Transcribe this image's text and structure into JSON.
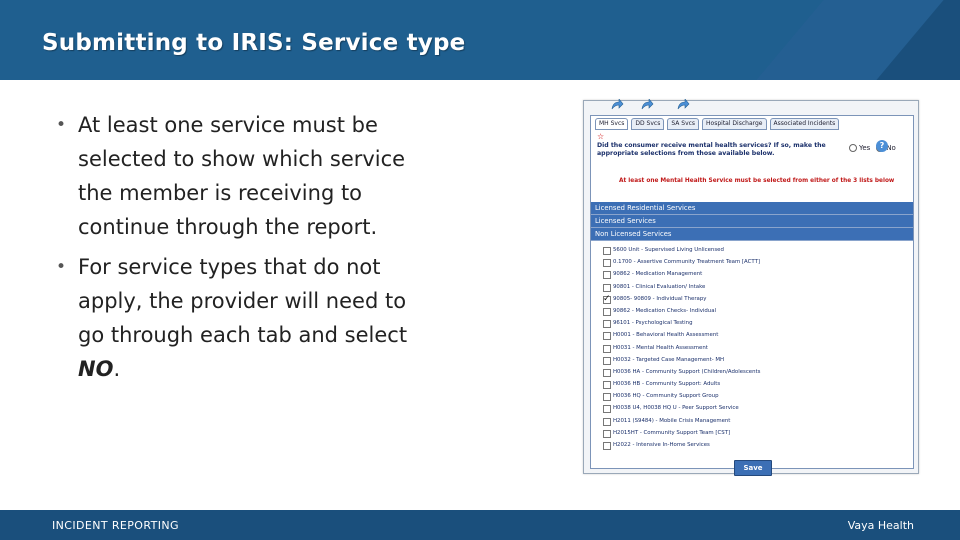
{
  "header": {
    "title": "Submitting to IRIS: Service type"
  },
  "bullets": [
    "At least one service must be selected to show which service the member is receiving to continue through the report.",
    "For service types that do not apply, the provider will need to go through each tab and select "
  ],
  "bullet2_emphasis": "NO",
  "bullet2_end": ".",
  "bullet_symbol": "•",
  "screenshot": {
    "tabs": [
      "MH Svcs",
      "DD Svcs",
      "SA Svcs",
      "Hospital Discharge",
      "Associated Incidents"
    ],
    "question": "Did the consumer receive mental health services? If so, make the appropriate selections from those available below.",
    "required_mark": "☆",
    "radio_yes": "Yes",
    "radio_no": "No",
    "help": "?",
    "warning": "At least one Mental Health Service must be selected from either of the 3 lists below",
    "sections": [
      "Licensed Residential Services",
      "Licensed Services",
      "Non Licensed Services"
    ],
    "services": [
      {
        "label": "5600 Unit - Supervised Living Unlicensed",
        "checked": false
      },
      {
        "label": "0.1700 - Assertive Community Treatment Team [ACTT]",
        "checked": false
      },
      {
        "label": "90862 - Medication Management",
        "checked": false
      },
      {
        "label": "90801 - Clinical Evaluation/ Intake",
        "checked": false
      },
      {
        "label": "90805- 90809 - Individual Therapy",
        "checked": true
      },
      {
        "label": "90862 - Medication Checks- Individual",
        "checked": false
      },
      {
        "label": "96101 - Psychological Testing",
        "checked": false
      },
      {
        "label": "H0001 - Behavioral Health Assessment",
        "checked": false
      },
      {
        "label": "H0031 - Mental Health Assessment",
        "checked": false
      },
      {
        "label": "H0032 - Targeted Case Management- MH",
        "checked": false
      },
      {
        "label": "H0036 HA - Community Support (Children/Adolescents",
        "checked": false
      },
      {
        "label": "H0036 HB - Community Support: Adults",
        "checked": false
      },
      {
        "label": "H0036 HQ - Community Support Group",
        "checked": false
      },
      {
        "label": "H0038 U4, H0038 HQ U - Peer Support Service",
        "checked": false
      },
      {
        "label": "H2011 (S9484) - Mobile Crisis Management",
        "checked": false
      },
      {
        "label": "H2015HT - Community Support Team [CST]",
        "checked": false
      },
      {
        "label": "H2022 - Intensive In-Home Services",
        "checked": false
      }
    ],
    "save_label": "Save"
  },
  "footer": {
    "left": "INCIDENT REPORTING",
    "right": "Vaya Health"
  },
  "colors": {
    "header": "#1f5f8f",
    "footer": "#1a4f7c",
    "section_bar": "#3c6fb5"
  }
}
